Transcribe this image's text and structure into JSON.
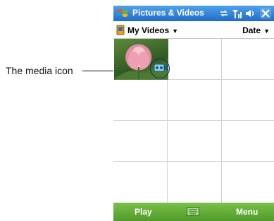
{
  "callout": {
    "label": "The media icon"
  },
  "titlebar": {
    "title": "Pictures & Videos",
    "icons": [
      "windows-start-icon",
      "connectivity-icon",
      "signal-icon",
      "volume-icon",
      "close-icon"
    ]
  },
  "toolbar": {
    "folder": "My Videos",
    "sort": "Date"
  },
  "grid": {
    "columns": 3,
    "rows": 4,
    "items": [
      {
        "type": "video",
        "thumbnail": "pink-lotus-flower"
      }
    ]
  },
  "softkeys": {
    "left": "Play",
    "right": "Menu"
  },
  "colors": {
    "title_bar": "#1f6cc8",
    "softkey_bar": "#5aa534",
    "callout_ring": "#1b2d55"
  }
}
